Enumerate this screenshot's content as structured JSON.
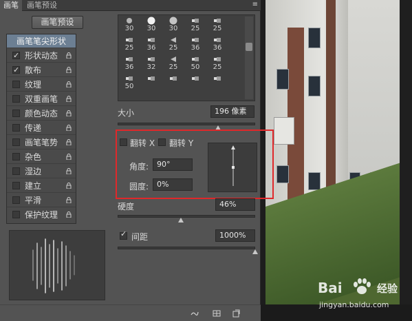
{
  "tabs": [
    {
      "label": "画笔",
      "active": true
    },
    {
      "label": "画笔预设",
      "active": false
    }
  ],
  "preset_button": "画笔预设",
  "sidebar": {
    "items": [
      {
        "label": "画笔笔尖形状",
        "checkbox": false,
        "checked": false,
        "selected": true,
        "lock": false
      },
      {
        "label": "形状动态",
        "checkbox": true,
        "checked": true,
        "selected": false,
        "lock": true
      },
      {
        "label": "散布",
        "checkbox": true,
        "checked": true,
        "selected": false,
        "lock": true
      },
      {
        "label": "纹理",
        "checkbox": true,
        "checked": false,
        "selected": false,
        "lock": true
      },
      {
        "label": "双重画笔",
        "checkbox": true,
        "checked": false,
        "selected": false,
        "lock": true
      },
      {
        "label": "颜色动态",
        "checkbox": true,
        "checked": false,
        "selected": false,
        "lock": true
      },
      {
        "label": "传递",
        "checkbox": true,
        "checked": false,
        "selected": false,
        "lock": true
      },
      {
        "label": "画笔笔势",
        "checkbox": true,
        "checked": false,
        "selected": false,
        "lock": true
      },
      {
        "label": "杂色",
        "checkbox": true,
        "checked": false,
        "selected": false,
        "lock": true
      },
      {
        "label": "湿边",
        "checkbox": true,
        "checked": false,
        "selected": false,
        "lock": true
      },
      {
        "label": "建立",
        "checkbox": true,
        "checked": false,
        "selected": false,
        "lock": true
      },
      {
        "label": "平滑",
        "checkbox": true,
        "checked": false,
        "selected": false,
        "lock": true
      },
      {
        "label": "保护纹理",
        "checkbox": true,
        "checked": false,
        "selected": false,
        "lock": true
      }
    ]
  },
  "brush_tips": {
    "rows": [
      [
        "30",
        "30",
        "30",
        "25",
        "25"
      ],
      [
        "25",
        "36",
        "25",
        "36",
        "36"
      ],
      [
        "36",
        "32",
        "25",
        "50",
        "25"
      ],
      [
        "50",
        "",
        "",
        "",
        ""
      ]
    ]
  },
  "size": {
    "label": "大小",
    "value": "196 像素",
    "slider_fraction": 0.73
  },
  "flip_x": {
    "label": "翻转 X",
    "checked": false
  },
  "flip_y": {
    "label": "翻转 Y",
    "checked": false
  },
  "angle": {
    "label": "角度:",
    "value": "90°"
  },
  "roundness": {
    "label": "圆度:",
    "value": "0%"
  },
  "hardness": {
    "label": "硬度",
    "value": "46%",
    "slider_fraction": 0.46
  },
  "spacing": {
    "label": "间距",
    "value": "1000%",
    "checked": true,
    "slider_fraction": 1.0
  },
  "watermark": {
    "text": "Bai",
    "cn": "经验",
    "url": "jingyan.baidu.com"
  },
  "colors": {
    "highlight": "#e0282a",
    "selected_row": "#6c7f93"
  }
}
